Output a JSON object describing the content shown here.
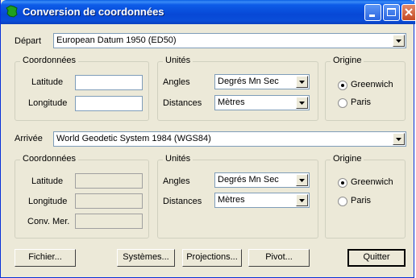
{
  "window": {
    "title": "Conversion de coordonnées"
  },
  "icons": {
    "app": "france-map-icon",
    "minimize": "minimize-icon",
    "maximize": "maximize-icon",
    "close": "close-icon"
  },
  "depart": {
    "label": "Départ",
    "datum": "European Datum 1950 (ED50)",
    "coords": {
      "title": "Coordonnées",
      "latitude_label": "Latitude",
      "latitude_value": "",
      "longitude_label": "Longitude",
      "longitude_value": ""
    },
    "units": {
      "title": "Unités",
      "angles_label": "Angles",
      "angles_value": "Degrés Mn Sec",
      "distances_label": "Distances",
      "distances_value": "Mètres"
    },
    "origin": {
      "title": "Origine",
      "options": [
        "Greenwich",
        "Paris"
      ],
      "selected": "Greenwich"
    }
  },
  "arrivee": {
    "label": "Arrivée",
    "datum": "World Geodetic System 1984 (WGS84)",
    "coords": {
      "title": "Coordonnées",
      "latitude_label": "Latitude",
      "longitude_label": "Longitude",
      "convmer_label": "Conv. Mer."
    },
    "units": {
      "title": "Unités",
      "angles_label": "Angles",
      "angles_value": "Degrés Mn Sec",
      "distances_label": "Distances",
      "distances_value": "Mètres"
    },
    "origin": {
      "title": "Origine",
      "options": [
        "Greenwich",
        "Paris"
      ],
      "selected": "Greenwich"
    }
  },
  "buttons": {
    "fichier": "Fichier...",
    "systemes": "Systèmes...",
    "projections": "Projections...",
    "pivot": "Pivot...",
    "quitter": "Quitter"
  }
}
